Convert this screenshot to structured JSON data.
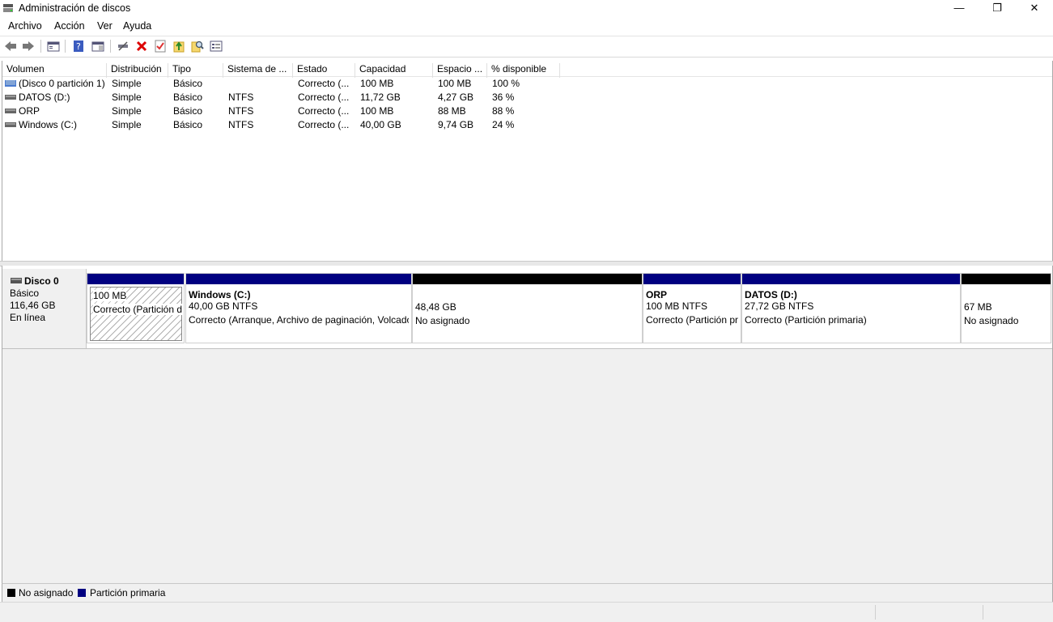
{
  "window": {
    "title": "Administración de discos",
    "minimize": "—",
    "maximize": "❐",
    "close": "✕"
  },
  "menu": [
    "Archivo",
    "Acción",
    "Ver",
    "Ayuda"
  ],
  "toolbar_icons": [
    "back-arrow-icon",
    "forward-arrow-icon",
    "console-tree-icon",
    "help-icon",
    "properties-pane-icon",
    "connect-disk-icon",
    "delete-icon",
    "check-icon",
    "import-icon",
    "search-icon",
    "list-view-icon"
  ],
  "columns": [
    "Volumen",
    "Distribución",
    "Tipo",
    "Sistema de ...",
    "Estado",
    "Capacidad",
    "Espacio ...",
    "% disponible"
  ],
  "volumes": [
    {
      "name": "(Disco 0 partición 1)",
      "layout": "Simple",
      "type": "Básico",
      "fs": "",
      "status": "Correcto (...",
      "capacity": "100 MB",
      "free": "100 MB",
      "pct": "100 %",
      "icon": "striped-volume-icon"
    },
    {
      "name": "DATOS (D:)",
      "layout": "Simple",
      "type": "Básico",
      "fs": "NTFS",
      "status": "Correcto (...",
      "capacity": "11,72 GB",
      "free": "4,27 GB",
      "pct": "36 %",
      "icon": "drive-icon"
    },
    {
      "name": "ORP",
      "layout": "Simple",
      "type": "Básico",
      "fs": "NTFS",
      "status": "Correcto (...",
      "capacity": "100 MB",
      "free": "88 MB",
      "pct": "88 %",
      "icon": "drive-icon"
    },
    {
      "name": "Windows (C:)",
      "layout": "Simple",
      "type": "Básico",
      "fs": "NTFS",
      "status": "Correcto (...",
      "capacity": "40,00 GB",
      "free": "9,74 GB",
      "pct": "24 %",
      "icon": "drive-icon"
    }
  ],
  "disk": {
    "name": "Disco 0",
    "type": "Básico",
    "size": "116,46 GB",
    "state": "En línea",
    "partitions": [
      {
        "title": "",
        "size": "100 MB",
        "status": "Correcto (Partición de sistema EFI)",
        "kind": "primary",
        "selected": true
      },
      {
        "title": "Windows  (C:)",
        "size": "40,00 GB NTFS",
        "status": "Correcto (Arranque, Archivo de paginación, Volcado, Partición primaria)",
        "kind": "primary"
      },
      {
        "title": "",
        "size": "48,48 GB",
        "status": "No asignado",
        "kind": "unallocated"
      },
      {
        "title": "ORP",
        "size": "100 MB NTFS",
        "status": "Correcto (Partición primaria)",
        "kind": "primary"
      },
      {
        "title": "DATOS  (D:)",
        "size": "27,72 GB NTFS",
        "status": "Correcto (Partición primaria)",
        "kind": "primary"
      },
      {
        "title": "",
        "size": "67 MB",
        "status": "No asignado",
        "kind": "unallocated"
      }
    ]
  },
  "legend": {
    "unallocated": "No asignado",
    "primary": "Partición primaria",
    "unallocated_color": "#000000",
    "primary_color": "#000080"
  }
}
